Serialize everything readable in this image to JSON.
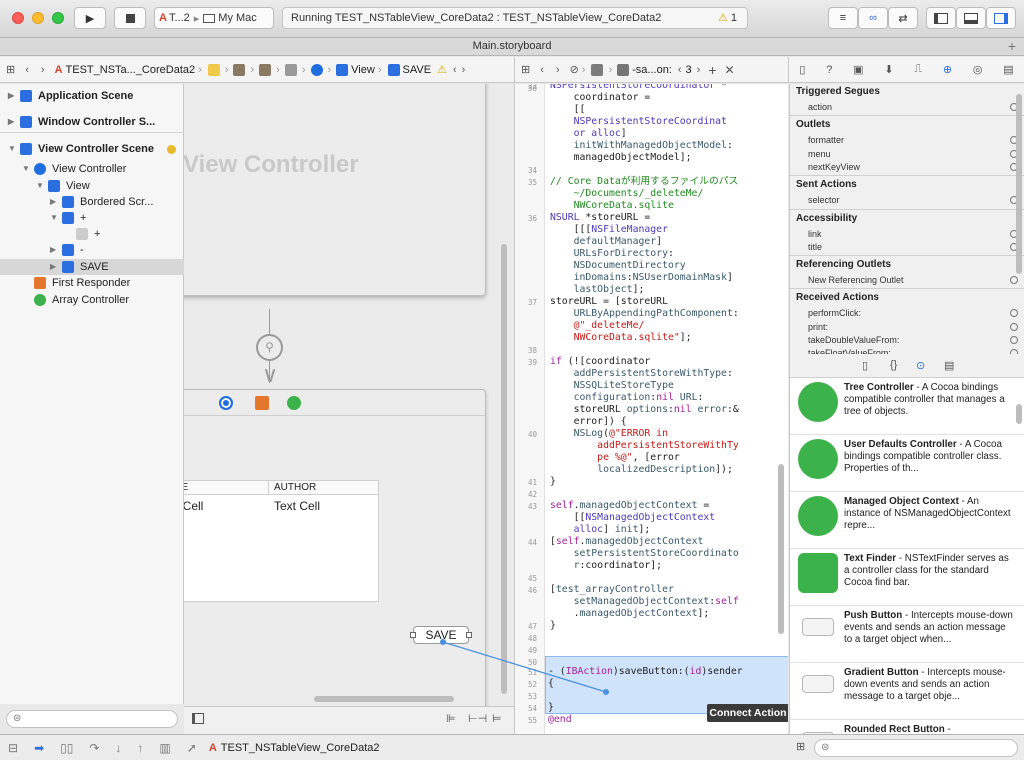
{
  "window": {
    "title": "Main.storyboard"
  },
  "toolbar": {
    "scheme_label": "T...2",
    "destination_label": "My Mac",
    "status_text": "Running TEST_NSTableView_CoreData2 : TEST_NSTableView_CoreData2",
    "warning_count": "1"
  },
  "jumpbar": {
    "project": "TEST_NSTa..._CoreData2",
    "view_label": "View",
    "save_label": "SAVE",
    "code_segment": "-sa...on:",
    "code_count": "3"
  },
  "outline": {
    "items": [
      {
        "label": "Application Scene",
        "bold": true,
        "disclosure": "▶",
        "indent": 0
      },
      {
        "label": "Window Controller S...",
        "bold": true,
        "disclosure": "▶",
        "indent": 0
      },
      {
        "label": "View Controller Scene",
        "bold": true,
        "disclosure": "▼",
        "indent": 0
      },
      {
        "label": "View Controller",
        "bold": false,
        "disclosure": "▼",
        "indent": 1
      },
      {
        "label": "View",
        "bold": false,
        "disclosure": "▼",
        "indent": 2
      },
      {
        "label": "Bordered Scr...",
        "bold": false,
        "disclosure": "▶",
        "indent": 3
      },
      {
        "label": "+",
        "bold": false,
        "disclosure": "▼",
        "indent": 3
      },
      {
        "label": "+",
        "bold": false,
        "disclosure": "",
        "indent": 4
      },
      {
        "label": "-",
        "bold": false,
        "disclosure": "▶",
        "indent": 3
      },
      {
        "label": "SAVE",
        "bold": false,
        "disclosure": "▶",
        "indent": 3
      },
      {
        "label": "First Responder",
        "bold": false,
        "disclosure": "",
        "indent": 1
      },
      {
        "label": "Array Controller",
        "bold": false,
        "disclosure": "",
        "indent": 1
      }
    ]
  },
  "canvas": {
    "vc_title": "View Controller",
    "table_headers": [
      "LE",
      "AUTHOR"
    ],
    "table_cells": [
      "t Cell",
      "Text Cell"
    ],
    "save_button": "SAVE"
  },
  "code": {
    "line_numbers": [
      "33",
      "",
      "",
      "",
      "",
      "",
      "",
      "34",
      "35",
      "",
      "",
      "36",
      "",
      "",
      "",
      "",
      "",
      "",
      "37",
      "",
      "",
      "",
      "38",
      "39",
      "",
      "",
      "",
      "",
      "40",
      "",
      "",
      "",
      "41",
      "42",
      "43",
      "",
      "",
      "44",
      "",
      "",
      "45",
      "46",
      "",
      "47",
      "48",
      "49",
      "50",
      "51",
      "52",
      "53",
      "54",
      "55",
      "56"
    ],
    "connect_tooltip": "Connect Action"
  },
  "inspector": {
    "sections": [
      {
        "title": "Triggered Segues",
        "items": [
          "action"
        ]
      },
      {
        "title": "Outlets",
        "items": [
          "formatter",
          "menu",
          "nextKeyView"
        ]
      },
      {
        "title": "Sent Actions",
        "items": [
          "selector"
        ]
      },
      {
        "title": "Accessibility",
        "items": [
          "link",
          "title"
        ]
      },
      {
        "title": "Referencing Outlets",
        "items": [
          "New Referencing Outlet"
        ]
      },
      {
        "title": "Received Actions",
        "items": [
          "performClick:",
          "print:",
          "takeDoubleValueFrom:",
          "takeFloatValueFrom:"
        ]
      }
    ]
  },
  "library": {
    "items": [
      {
        "name": "Tree Controller",
        "desc": " - A Cocoa bindings compatible controller that manages a tree of objects."
      },
      {
        "name": "User Defaults Controller",
        "desc": " - A Cocoa bindings compatible controller class. Properties of th..."
      },
      {
        "name": "Managed Object Context",
        "desc": " - An instance of NSManagedObjectContext repre..."
      },
      {
        "name": "Text Finder",
        "desc": " - NSTextFinder serves as a controller class for the standard Cocoa find bar."
      },
      {
        "name": "Push Button",
        "desc": " - Intercepts mouse-down events and sends an action message to a target object when..."
      },
      {
        "name": "Gradient Button",
        "desc": " - Intercepts mouse-down events and sends an action message to a target obje..."
      },
      {
        "name": "Rounded Rect Button",
        "desc": " -"
      }
    ]
  },
  "bottombar": {
    "scheme": "TEST_NSTableView_CoreData2"
  }
}
